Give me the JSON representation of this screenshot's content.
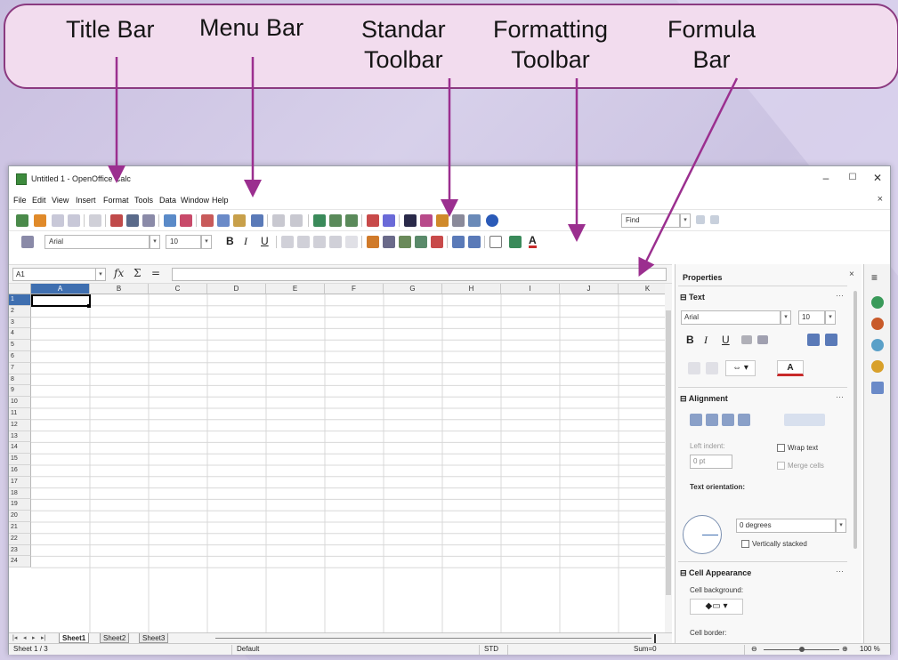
{
  "callout": {
    "labels": {
      "title_bar": "Title Bar",
      "menu_bar": "Menu Bar",
      "standard_toolbar": "Standar\nToolbar",
      "formatting_toolbar": "Formatting\nToolbar",
      "formula_bar": "Formula\nBar"
    }
  },
  "window": {
    "title": "Untitled 1 - OpenOffice Calc",
    "controls": {
      "minimize": "–",
      "maximize": "☐",
      "close": "✕"
    },
    "menu": [
      "File",
      "Edit",
      "View",
      "Insert",
      "Format",
      "Tools",
      "Data",
      "Window",
      "Help"
    ],
    "menu_close": "×",
    "standard_toolbar": {
      "find_placeholder": "Find"
    },
    "formatting_toolbar": {
      "font_name": "Arial",
      "font_size": "10"
    },
    "formula_bar": {
      "name_box": "A1",
      "fx": "fx",
      "sum": "Σ",
      "equals": "="
    },
    "columns": [
      "A",
      "B",
      "C",
      "D",
      "E",
      "F",
      "G",
      "H",
      "I",
      "J",
      "K"
    ],
    "rows": [
      "1",
      "2",
      "3",
      "4",
      "5",
      "6",
      "7",
      "8",
      "9",
      "10",
      "11",
      "12",
      "13",
      "14",
      "15",
      "16",
      "17",
      "18",
      "19",
      "20",
      "21",
      "22",
      "23",
      "24"
    ],
    "sheet_tabs": [
      "Sheet1",
      "Sheet2",
      "Sheet3"
    ],
    "status": {
      "sheet": "Sheet 1 / 3",
      "style": "Default",
      "mode": "STD",
      "sum": "Sum=0",
      "zoom": "100 %"
    }
  },
  "sidebar": {
    "title": "Properties",
    "text_section": {
      "title": "Text",
      "font_name": "Arial",
      "font_size": "10",
      "bold": "B",
      "italic": "I",
      "underline": "U",
      "font_color": "A"
    },
    "alignment_section": {
      "title": "Alignment",
      "left_indent_label": "Left indent:",
      "left_indent_value": "0 pt",
      "wrap_text": "Wrap text",
      "merge_cells": "Merge cells",
      "text_orientation_label": "Text orientation:",
      "orientation_value": "0 degrees",
      "vertically_stacked": "Vertically stacked"
    },
    "cell_appearance_section": {
      "title": "Cell Appearance",
      "cell_background_label": "Cell background:",
      "cell_border_label": "Cell border:"
    }
  },
  "colors": {
    "accent": "#3f6fb0",
    "callout_fill": "#f2dcee",
    "callout_border": "#8b3a80",
    "arrow": "#9b2f8f"
  }
}
